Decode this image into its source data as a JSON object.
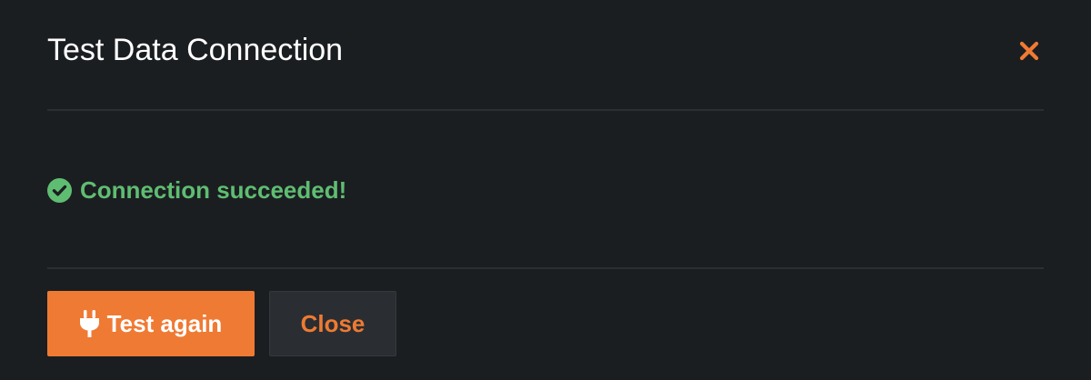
{
  "dialog": {
    "title": "Test Data Connection",
    "close_icon": "close-x-icon"
  },
  "status": {
    "icon": "check-circle-icon",
    "message": "Connection succeeded!"
  },
  "footer": {
    "test_again_label": "Test again",
    "test_again_icon": "plug-icon",
    "close_label": "Close"
  },
  "colors": {
    "background": "#1b1e21",
    "accent": "#ef7a33",
    "success": "#5fbd72",
    "divider": "#2b2f33",
    "title_text": "#ffffff"
  }
}
